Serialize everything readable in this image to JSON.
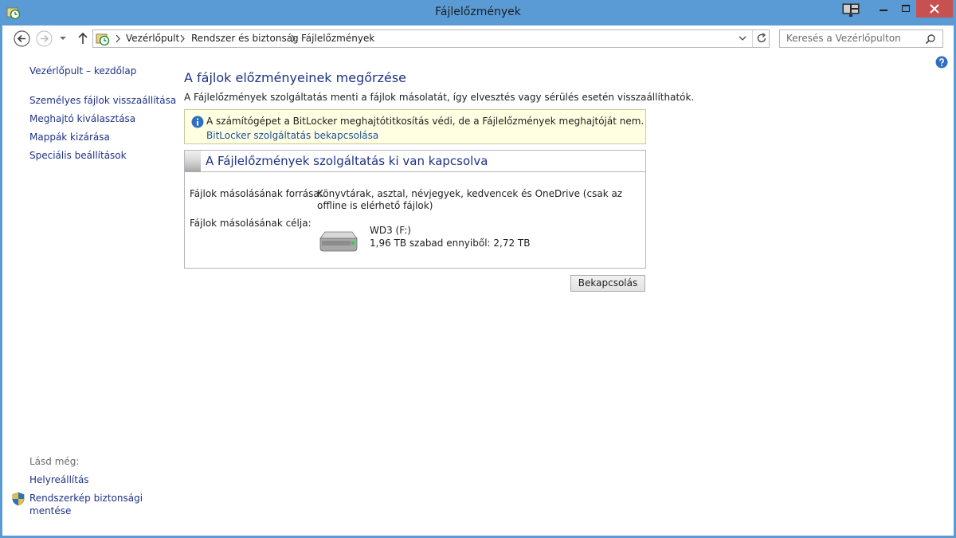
{
  "window": {
    "title": "Fájlelőzmények"
  },
  "nav": {
    "breadcrumbs": [
      "Vezérlőpult",
      "Rendszer és biztonság",
      "Fájlelőzmények"
    ],
    "search_placeholder": "Keresés a Vezérlőpulton"
  },
  "sidebar": {
    "home_link": "Vezérlőpult – kezdőlap",
    "tasks": [
      "Személyes fájlok visszaállítása",
      "Meghajtó kiválasztása",
      "Mappák kizárása",
      "Speciális beállítások"
    ],
    "see_also_label": "Lásd még:",
    "see_also": [
      "Helyreállítás",
      "Rendszerkép biztonsági mentése"
    ]
  },
  "main": {
    "title": "A fájlok előzményeinek megőrzése",
    "description": "A Fájlelőzmények szolgáltatás menti a fájlok másolatát, így elvesztés vagy sérülés esetén visszaállíthatók.",
    "info": {
      "message": "A számítógépet a BitLocker meghajtótitkosítás védi, de a Fájlelőzmények meghajtóját nem.",
      "link": "BitLocker szolgáltatás bekapcsolása"
    },
    "status": {
      "title": "A Fájlelőzmények szolgáltatás ki van kapcsolva",
      "source_label": "Fájlok másolásának forrása:",
      "source_value": "Könyvtárak, asztal, névjegyek, kedvencek és OneDrive (csak az offline is elérhető fájlok)",
      "target_label": "Fájlok másolásának célja:",
      "drive_name": "WD3 (F:)",
      "drive_space": "1,96 TB szabad ennyiből: 2,72 TB"
    },
    "enable_button": "Bekapcsolás"
  },
  "colors": {
    "frame": "#5b9bd5",
    "close": "#c75050",
    "link": "#1e3287",
    "info_bg": "#ffffe1"
  },
  "icons": {
    "app": "file-history-icon",
    "snap": "snap-layout-icon",
    "back": "back-arrow-icon",
    "forward": "forward-arrow-icon",
    "up": "up-arrow-icon",
    "refresh": "refresh-icon",
    "search": "search-icon",
    "help": "help-icon",
    "info": "info-icon",
    "drive": "hard-drive-icon",
    "shield": "uac-shield-icon"
  }
}
